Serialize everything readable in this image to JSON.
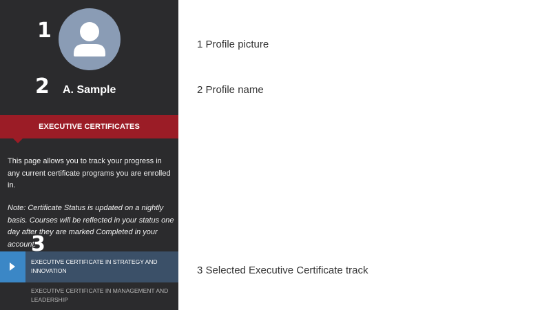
{
  "callouts": {
    "one": "1",
    "two": "2",
    "three": "3"
  },
  "profile": {
    "name": "A. Sample"
  },
  "section": {
    "title": "EXECUTIVE CERTIFICATES"
  },
  "description": "This page allows you to track your progress in any current certificate programs you are enrolled in.",
  "note": "Note: Certificate Status is updated on a nightly basis. Courses will be reflected in your status one day after they are marked Completed in your account.",
  "tracks": [
    {
      "label": "EXECUTIVE CERTIFICATE IN STRATEGY AND INNOVATION",
      "selected": true
    },
    {
      "label": "EXECUTIVE CERTIFICATE IN MANAGEMENT AND LEADERSHIP",
      "selected": false
    }
  ],
  "legend": [
    {
      "label": "1 Profile picture"
    },
    {
      "label": "2 Profile name"
    },
    {
      "label": "3 Selected Executive Certificate track"
    }
  ],
  "colors": {
    "sidebar_bg": "#2b2b2d",
    "header_red": "#9b1c26",
    "selected_bg": "#3b5068",
    "play_blue": "#3b87c6",
    "avatar_bg": "#8a9cb5"
  },
  "icons": {
    "avatar": "user-icon",
    "play": "play-icon"
  }
}
